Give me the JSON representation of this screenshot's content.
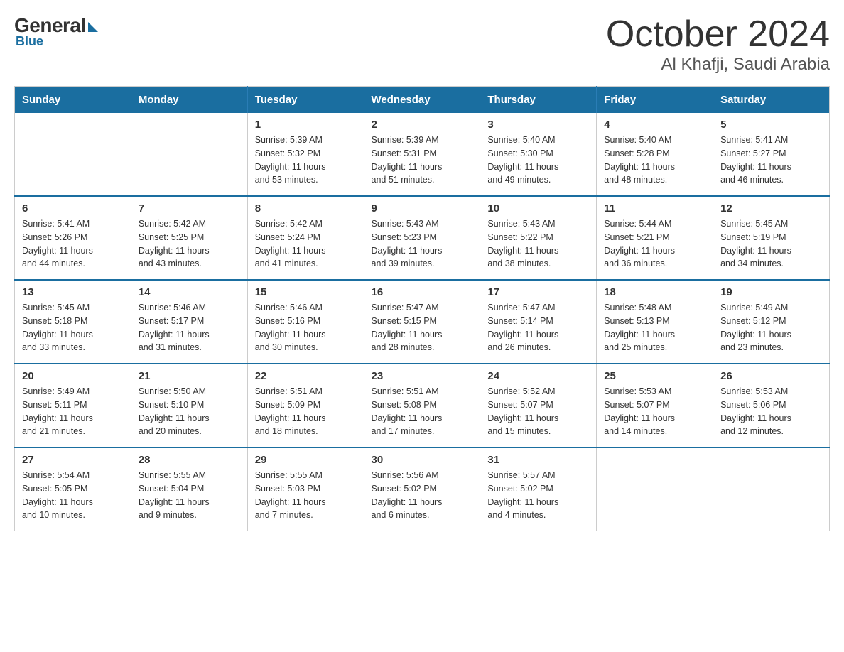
{
  "header": {
    "logo": {
      "general": "General",
      "blue": "Blue"
    },
    "title": "October 2024",
    "location": "Al Khafji, Saudi Arabia"
  },
  "days_header": [
    "Sunday",
    "Monday",
    "Tuesday",
    "Wednesday",
    "Thursday",
    "Friday",
    "Saturday"
  ],
  "weeks": [
    [
      {
        "day": "",
        "info": ""
      },
      {
        "day": "",
        "info": ""
      },
      {
        "day": "1",
        "info": "Sunrise: 5:39 AM\nSunset: 5:32 PM\nDaylight: 11 hours\nand 53 minutes."
      },
      {
        "day": "2",
        "info": "Sunrise: 5:39 AM\nSunset: 5:31 PM\nDaylight: 11 hours\nand 51 minutes."
      },
      {
        "day": "3",
        "info": "Sunrise: 5:40 AM\nSunset: 5:30 PM\nDaylight: 11 hours\nand 49 minutes."
      },
      {
        "day": "4",
        "info": "Sunrise: 5:40 AM\nSunset: 5:28 PM\nDaylight: 11 hours\nand 48 minutes."
      },
      {
        "day": "5",
        "info": "Sunrise: 5:41 AM\nSunset: 5:27 PM\nDaylight: 11 hours\nand 46 minutes."
      }
    ],
    [
      {
        "day": "6",
        "info": "Sunrise: 5:41 AM\nSunset: 5:26 PM\nDaylight: 11 hours\nand 44 minutes."
      },
      {
        "day": "7",
        "info": "Sunrise: 5:42 AM\nSunset: 5:25 PM\nDaylight: 11 hours\nand 43 minutes."
      },
      {
        "day": "8",
        "info": "Sunrise: 5:42 AM\nSunset: 5:24 PM\nDaylight: 11 hours\nand 41 minutes."
      },
      {
        "day": "9",
        "info": "Sunrise: 5:43 AM\nSunset: 5:23 PM\nDaylight: 11 hours\nand 39 minutes."
      },
      {
        "day": "10",
        "info": "Sunrise: 5:43 AM\nSunset: 5:22 PM\nDaylight: 11 hours\nand 38 minutes."
      },
      {
        "day": "11",
        "info": "Sunrise: 5:44 AM\nSunset: 5:21 PM\nDaylight: 11 hours\nand 36 minutes."
      },
      {
        "day": "12",
        "info": "Sunrise: 5:45 AM\nSunset: 5:19 PM\nDaylight: 11 hours\nand 34 minutes."
      }
    ],
    [
      {
        "day": "13",
        "info": "Sunrise: 5:45 AM\nSunset: 5:18 PM\nDaylight: 11 hours\nand 33 minutes."
      },
      {
        "day": "14",
        "info": "Sunrise: 5:46 AM\nSunset: 5:17 PM\nDaylight: 11 hours\nand 31 minutes."
      },
      {
        "day": "15",
        "info": "Sunrise: 5:46 AM\nSunset: 5:16 PM\nDaylight: 11 hours\nand 30 minutes."
      },
      {
        "day": "16",
        "info": "Sunrise: 5:47 AM\nSunset: 5:15 PM\nDaylight: 11 hours\nand 28 minutes."
      },
      {
        "day": "17",
        "info": "Sunrise: 5:47 AM\nSunset: 5:14 PM\nDaylight: 11 hours\nand 26 minutes."
      },
      {
        "day": "18",
        "info": "Sunrise: 5:48 AM\nSunset: 5:13 PM\nDaylight: 11 hours\nand 25 minutes."
      },
      {
        "day": "19",
        "info": "Sunrise: 5:49 AM\nSunset: 5:12 PM\nDaylight: 11 hours\nand 23 minutes."
      }
    ],
    [
      {
        "day": "20",
        "info": "Sunrise: 5:49 AM\nSunset: 5:11 PM\nDaylight: 11 hours\nand 21 minutes."
      },
      {
        "day": "21",
        "info": "Sunrise: 5:50 AM\nSunset: 5:10 PM\nDaylight: 11 hours\nand 20 minutes."
      },
      {
        "day": "22",
        "info": "Sunrise: 5:51 AM\nSunset: 5:09 PM\nDaylight: 11 hours\nand 18 minutes."
      },
      {
        "day": "23",
        "info": "Sunrise: 5:51 AM\nSunset: 5:08 PM\nDaylight: 11 hours\nand 17 minutes."
      },
      {
        "day": "24",
        "info": "Sunrise: 5:52 AM\nSunset: 5:07 PM\nDaylight: 11 hours\nand 15 minutes."
      },
      {
        "day": "25",
        "info": "Sunrise: 5:53 AM\nSunset: 5:07 PM\nDaylight: 11 hours\nand 14 minutes."
      },
      {
        "day": "26",
        "info": "Sunrise: 5:53 AM\nSunset: 5:06 PM\nDaylight: 11 hours\nand 12 minutes."
      }
    ],
    [
      {
        "day": "27",
        "info": "Sunrise: 5:54 AM\nSunset: 5:05 PM\nDaylight: 11 hours\nand 10 minutes."
      },
      {
        "day": "28",
        "info": "Sunrise: 5:55 AM\nSunset: 5:04 PM\nDaylight: 11 hours\nand 9 minutes."
      },
      {
        "day": "29",
        "info": "Sunrise: 5:55 AM\nSunset: 5:03 PM\nDaylight: 11 hours\nand 7 minutes."
      },
      {
        "day": "30",
        "info": "Sunrise: 5:56 AM\nSunset: 5:02 PM\nDaylight: 11 hours\nand 6 minutes."
      },
      {
        "day": "31",
        "info": "Sunrise: 5:57 AM\nSunset: 5:02 PM\nDaylight: 11 hours\nand 4 minutes."
      },
      {
        "day": "",
        "info": ""
      },
      {
        "day": "",
        "info": ""
      }
    ]
  ]
}
